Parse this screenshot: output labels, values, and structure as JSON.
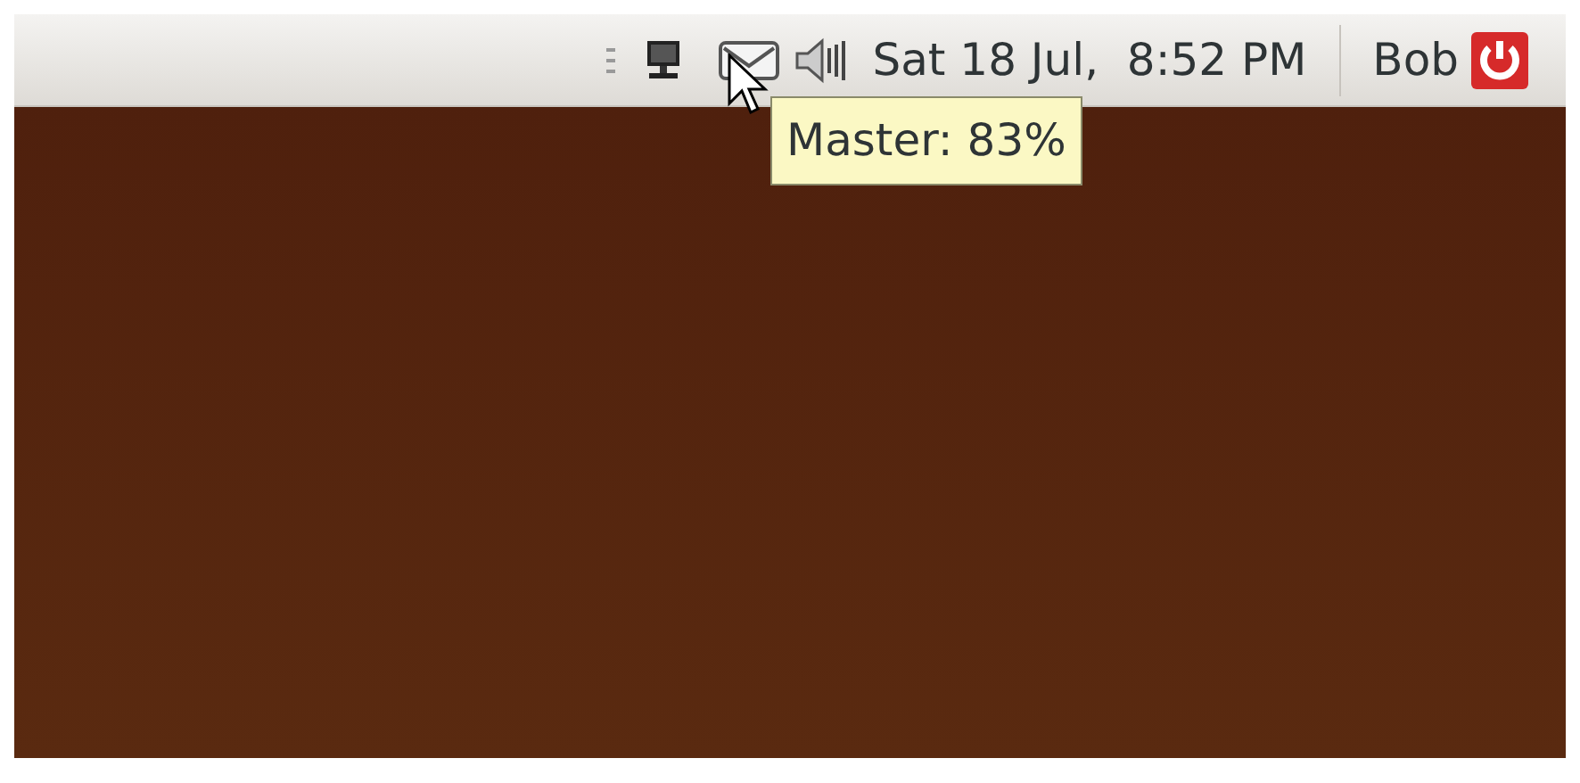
{
  "panel": {
    "clock": "Sat 18 Jul,  8:52 PM",
    "user": "Bob"
  },
  "tooltip": {
    "text": "Master: 83%"
  }
}
